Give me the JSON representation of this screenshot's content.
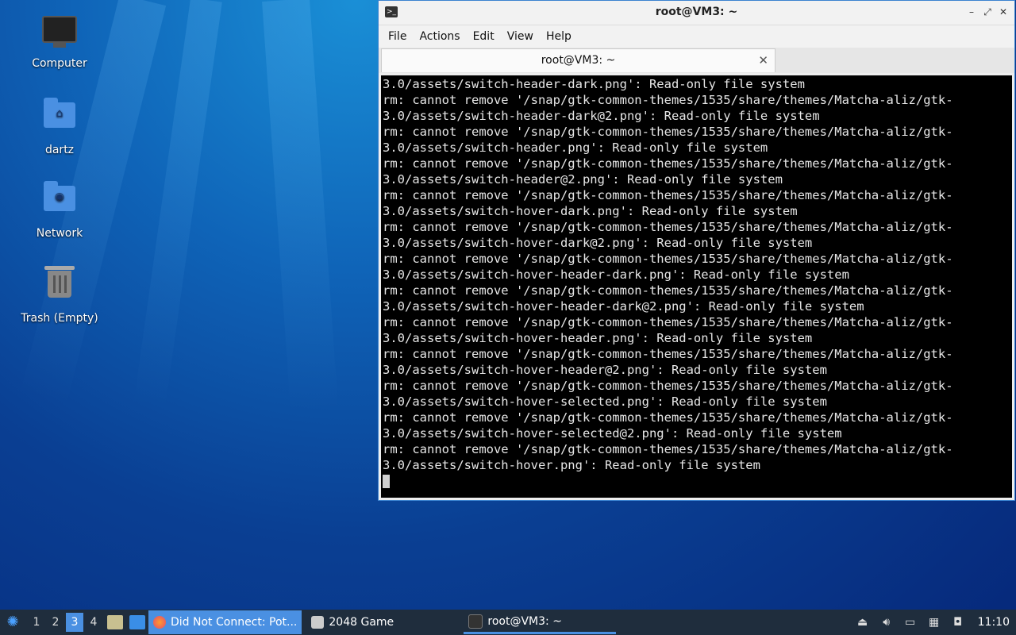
{
  "desktop": {
    "icons": [
      {
        "label": "Computer"
      },
      {
        "label": "dartz"
      },
      {
        "label": "Network"
      },
      {
        "label": "Trash (Empty)"
      }
    ]
  },
  "terminal": {
    "window_title": "root@VM3: ~",
    "menu": [
      "File",
      "Actions",
      "Edit",
      "View",
      "Help"
    ],
    "tab_title": "root@VM3: ~",
    "lines": [
      "3.0/assets/switch-header-dark.png': Read-only file system",
      "rm: cannot remove '/snap/gtk-common-themes/1535/share/themes/Matcha-aliz/gtk-",
      "3.0/assets/switch-header-dark@2.png': Read-only file system",
      "rm: cannot remove '/snap/gtk-common-themes/1535/share/themes/Matcha-aliz/gtk-",
      "3.0/assets/switch-header.png': Read-only file system",
      "rm: cannot remove '/snap/gtk-common-themes/1535/share/themes/Matcha-aliz/gtk-",
      "3.0/assets/switch-header@2.png': Read-only file system",
      "rm: cannot remove '/snap/gtk-common-themes/1535/share/themes/Matcha-aliz/gtk-",
      "3.0/assets/switch-hover-dark.png': Read-only file system",
      "rm: cannot remove '/snap/gtk-common-themes/1535/share/themes/Matcha-aliz/gtk-",
      "3.0/assets/switch-hover-dark@2.png': Read-only file system",
      "rm: cannot remove '/snap/gtk-common-themes/1535/share/themes/Matcha-aliz/gtk-",
      "3.0/assets/switch-hover-header-dark.png': Read-only file system",
      "rm: cannot remove '/snap/gtk-common-themes/1535/share/themes/Matcha-aliz/gtk-",
      "3.0/assets/switch-hover-header-dark@2.png': Read-only file system",
      "rm: cannot remove '/snap/gtk-common-themes/1535/share/themes/Matcha-aliz/gtk-",
      "3.0/assets/switch-hover-header.png': Read-only file system",
      "rm: cannot remove '/snap/gtk-common-themes/1535/share/themes/Matcha-aliz/gtk-",
      "3.0/assets/switch-hover-header@2.png': Read-only file system",
      "rm: cannot remove '/snap/gtk-common-themes/1535/share/themes/Matcha-aliz/gtk-",
      "3.0/assets/switch-hover-selected.png': Read-only file system",
      "rm: cannot remove '/snap/gtk-common-themes/1535/share/themes/Matcha-aliz/gtk-",
      "3.0/assets/switch-hover-selected@2.png': Read-only file system",
      "rm: cannot remove '/snap/gtk-common-themes/1535/share/themes/Matcha-aliz/gtk-",
      "3.0/assets/switch-hover.png': Read-only file system"
    ]
  },
  "taskbar": {
    "workspaces": [
      "1",
      "2",
      "3",
      "4"
    ],
    "active_workspace": "3",
    "tasks": [
      {
        "label": "Did Not Connect: Pot..."
      },
      {
        "label": "2048 Game"
      },
      {
        "label": "root@VM3: ~"
      }
    ],
    "clock": "11:10"
  },
  "colors": {
    "accent": "#4a90e2",
    "taskbar": "#1f2d3d",
    "console_bg": "#000000"
  }
}
